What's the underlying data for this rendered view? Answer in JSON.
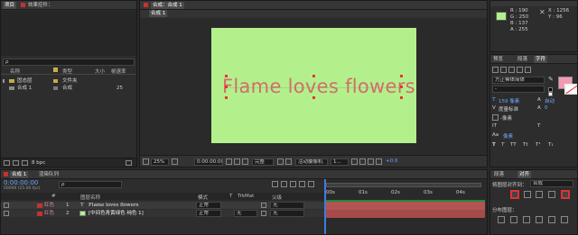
{
  "colors": {
    "canvas": "#b3f08c",
    "comp_title": "#d36c6c",
    "layer_label_red": "#c23232",
    "layer_bar_text": "#b35454",
    "accent_blue": "#2f6fc9",
    "fill_pink": "#f29ab2"
  },
  "project": {
    "tab_label": "项目",
    "tab_effects": "效果控件：",
    "search_placeholder": "ρ",
    "columns": {
      "name": "名称",
      "type": "类型",
      "size": "大小",
      "frame_rate": "帧速率"
    },
    "items": [
      {
        "name": "固态层",
        "type": "文件夹",
        "size": "",
        "rate": ""
      },
      {
        "name": "合成 1",
        "type": "合成",
        "size": "",
        "rate": "25"
      }
    ],
    "bit_depth": "8 bpc"
  },
  "composition": {
    "tab_label": "合成：合成 1",
    "sub_tab": "合成 1",
    "title_text": "Flame loves flowers",
    "zoom": "25%",
    "timecode": "0:00:00:00",
    "quality": "完整",
    "camera": "活动摄像机",
    "views": "1...",
    "exposure": "+0.0"
  },
  "info": {
    "r": "R : 190",
    "g": "G : 250",
    "b": "B : 137",
    "a": "A : 255",
    "x": "X : 1256",
    "y": "Y : 96"
  },
  "character": {
    "tab_preview": "预览",
    "tab_paragraph": "段落",
    "tab_character": "字符",
    "font_family": "方正稀体简体",
    "font_style": "-",
    "font_size": "159 像素",
    "leading": "自动",
    "tracking": "度量标准",
    "tracking_value": "0",
    "baseline": "-像素",
    "unit_px": "像素"
  },
  "align": {
    "tab_label": "对齐",
    "align_to_label": "将图层对齐到：",
    "align_to_value": "合成",
    "distribute_label": "分布图层："
  },
  "timeline": {
    "tab_label": "合成 1",
    "render_tab": "渲染队列",
    "timecode": "0:00:00:00",
    "frame_info": "00000 (25.00 fps)",
    "search_placeholder": "ρ",
    "col_num": "#",
    "col_name": "图层名称",
    "col_mode": "模式",
    "col_t": "T",
    "col_trkmat": "TrkMat",
    "col_parent": "父级",
    "ruler_marks": [
      "00s",
      "01s",
      "02s",
      "03s",
      "04s"
    ],
    "layers": [
      {
        "label": "红色",
        "num": "1",
        "icon": "T",
        "name": "Flame loves flowers",
        "mode": "正常",
        "trkmat": "",
        "parent": "无"
      },
      {
        "label": "红色",
        "num": "2",
        "icon": "",
        "name": "[中间色青黄绿色 纯色 1]",
        "mode": "正常",
        "trkmat": "无",
        "parent": "无"
      }
    ]
  }
}
